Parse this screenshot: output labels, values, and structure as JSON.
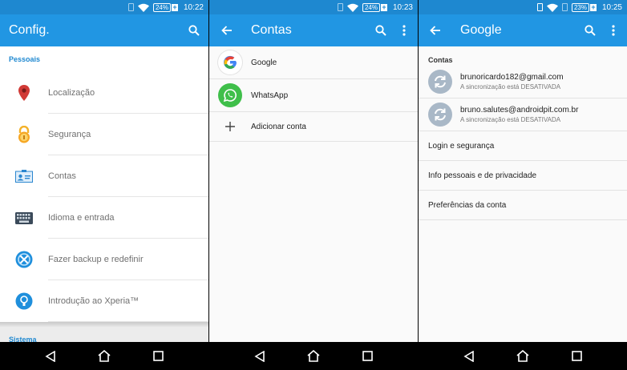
{
  "status_bars": [
    {
      "battery": "24%",
      "time": "10:22"
    },
    {
      "battery": "24%",
      "time": "10:23"
    },
    {
      "battery": "23%",
      "time": "10:25"
    }
  ],
  "screen1": {
    "title": "Config.",
    "section_personal": "Pessoais",
    "items": [
      {
        "label": "Localização",
        "icon": "location-pin-icon"
      },
      {
        "label": "Segurança",
        "icon": "lock-icon"
      },
      {
        "label": "Contas",
        "icon": "id-card-icon"
      },
      {
        "label": "Idioma e entrada",
        "icon": "keyboard-icon"
      },
      {
        "label": "Fazer backup e redefinir",
        "icon": "backup-icon"
      },
      {
        "label": "Introdução ao Xperia™",
        "icon": "lightbulb-icon"
      }
    ],
    "section_system": "Sistema"
  },
  "screen2": {
    "title": "Contas",
    "accounts": [
      {
        "label": "Google",
        "icon": "google-logo-icon"
      },
      {
        "label": "WhatsApp",
        "icon": "whatsapp-logo-icon"
      }
    ],
    "add_account": "Adicionar conta"
  },
  "screen3": {
    "title": "Google",
    "section_accounts": "Contas",
    "accounts": [
      {
        "email": "brunoricardo182@gmail.com",
        "status": "A sincronização está DESATIVADA"
      },
      {
        "email": "bruno.salutes@androidpit.com.br",
        "status": "A sincronização está DESATIVADA"
      }
    ],
    "options": [
      "Login e segurança",
      "Info pessoais e de privacidade",
      "Preferências da conta"
    ]
  },
  "colors": {
    "statusbar": "#1e88d0",
    "appbar": "#2196e3",
    "accent": "#1e88d0"
  }
}
